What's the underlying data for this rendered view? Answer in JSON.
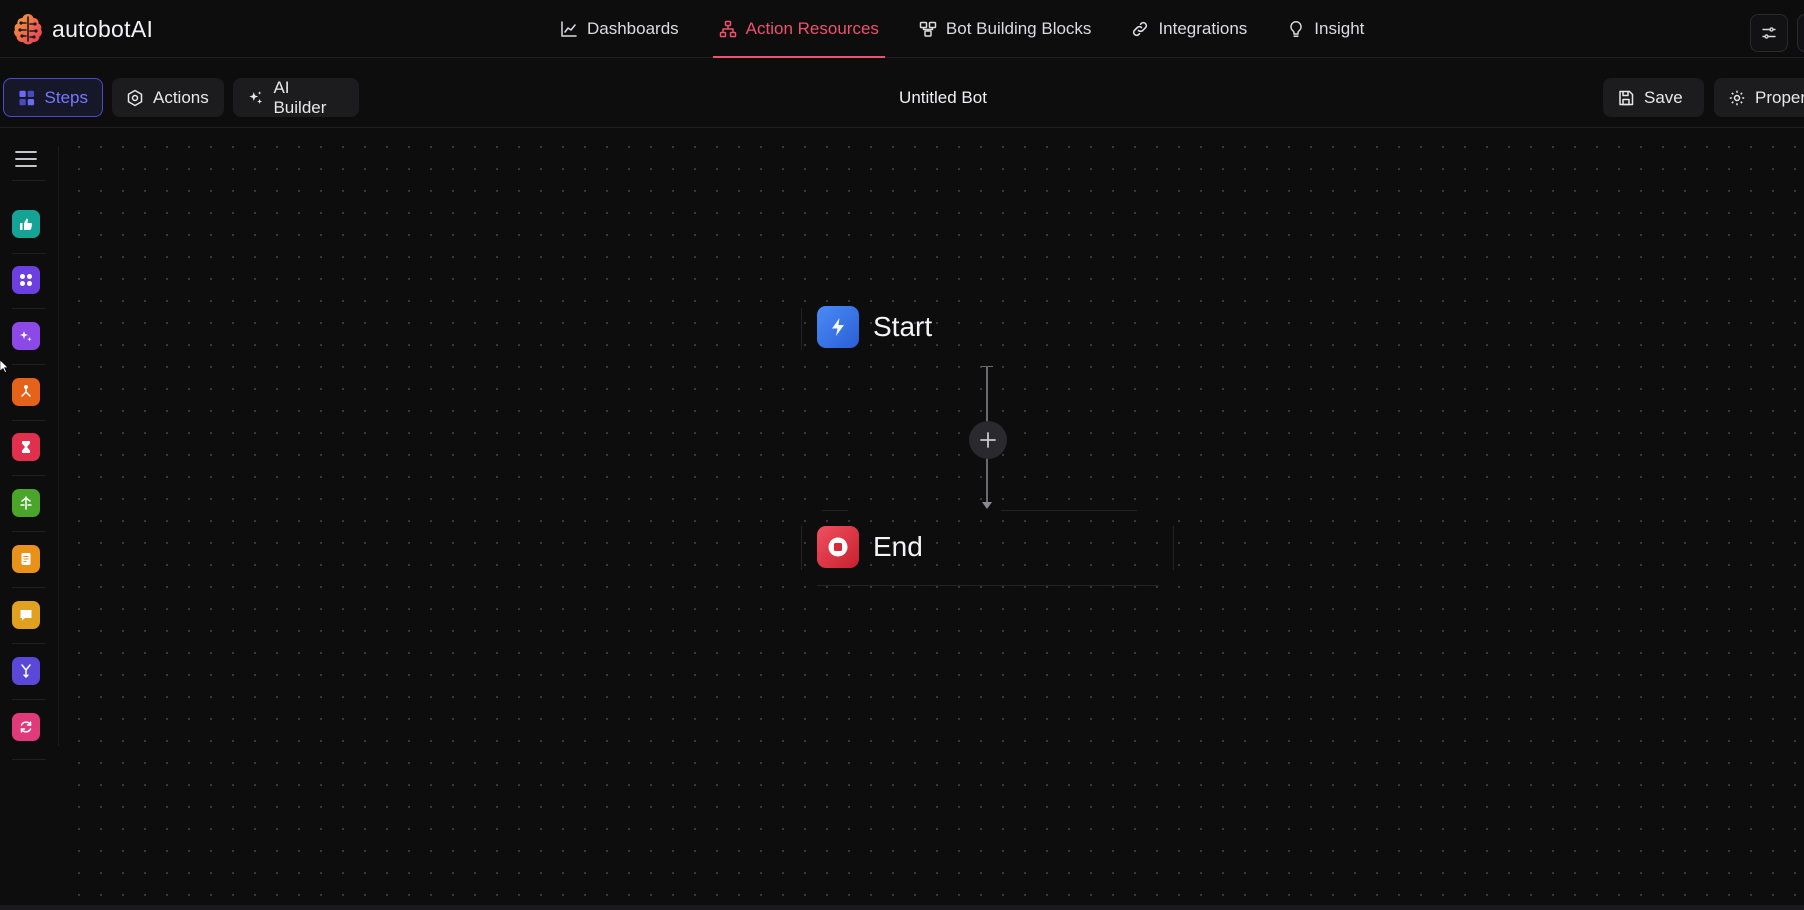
{
  "brand": {
    "name": "autobotAI"
  },
  "nav": {
    "items": [
      {
        "label": "Dashboards",
        "icon": "chart-line-icon"
      },
      {
        "label": "Action Resources",
        "icon": "hierarchy-icon",
        "active": true
      },
      {
        "label": "Bot Building Blocks",
        "icon": "blocks-icon"
      },
      {
        "label": "Integrations",
        "icon": "link-icon"
      },
      {
        "label": "Insight",
        "icon": "lightbulb-icon"
      }
    ],
    "accent": "#f0506e"
  },
  "toolbar": {
    "steps_label": "Steps",
    "actions_label": "Actions",
    "ai_builder_label": "AI Builder",
    "bot_title": "Untitled Bot",
    "save_label": "Save",
    "properties_label": "Proper"
  },
  "rail": {
    "items": [
      {
        "name": "thumbs-up-icon",
        "color": "#14a394"
      },
      {
        "name": "apps-grid-icon",
        "color": "#6b3fe0"
      },
      {
        "name": "sparkles-icon",
        "color": "#8c49e8"
      },
      {
        "name": "fork-icon",
        "color": "#e5621a"
      },
      {
        "name": "hourglass-icon",
        "color": "#e0304e"
      },
      {
        "name": "split-arrows-icon",
        "color": "#4aa52a"
      },
      {
        "name": "document-icon",
        "color": "#e8921a"
      },
      {
        "name": "chat-icon",
        "color": "#e0a020"
      },
      {
        "name": "merge-icon",
        "color": "#5a48d8"
      },
      {
        "name": "refresh-icon",
        "color": "#e03a7a"
      }
    ]
  },
  "flow": {
    "start_label": "Start",
    "end_label": "End"
  }
}
